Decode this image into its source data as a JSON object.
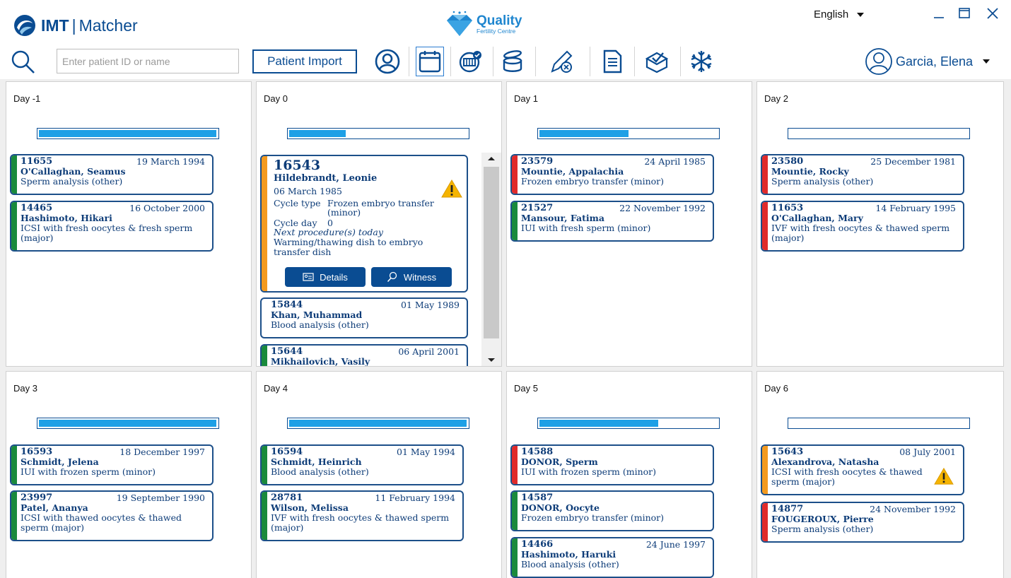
{
  "header": {
    "brand_imt": "IMT",
    "brand_sep": "|",
    "brand_product": "Matcher",
    "clinic_name": "Quality",
    "clinic_sub": "Fertility Centre",
    "language": "English",
    "search_placeholder": "Enter patient ID or name",
    "import_label": "Patient Import",
    "user_name": "Garcia, Elena"
  },
  "colors": {
    "brand": "#0a4c92",
    "progress": "#1ea0e6",
    "green": "#1a8a3c",
    "red": "#e02b2b",
    "orange": "#f39a1f"
  },
  "toolbar": {
    "icons": [
      "patient-icon",
      "calendar-icon",
      "incubator-icon",
      "dish-stack-icon",
      "tube-icon",
      "pen-cancel-icon",
      "document-icon",
      "verified-box-icon",
      "snowflake-icon"
    ]
  },
  "days": [
    {
      "title": "Day -1",
      "progress": 1.0
    },
    {
      "title": "Day 0",
      "progress": 0.32
    },
    {
      "title": "Day 1",
      "progress": 0.5
    },
    {
      "title": "Day 2",
      "progress": 0.0
    },
    {
      "title": "Day 3",
      "progress": 1.0
    },
    {
      "title": "Day 4",
      "progress": 1.0
    },
    {
      "title": "Day 5",
      "progress": 0.67
    },
    {
      "title": "Day 6",
      "progress": 0.0
    }
  ],
  "cards": {
    "d_1": [
      {
        "id": "11655",
        "date": "19 March 1994",
        "name": "O'Callaghan, Seamus",
        "proc": "Sperm analysis (other)",
        "status": "green"
      },
      {
        "id": "14465",
        "date": "16 October 2000",
        "name": "Hashimoto, Hikari",
        "proc": "ICSI with fresh oocytes & fresh sperm",
        "proc2": "(major)",
        "status": "green"
      }
    ],
    "d0_expanded": {
      "id": "16543",
      "name": "Hildebrandt, Leonie",
      "dob": "06 March 1985",
      "cycle_type_label": "Cycle type",
      "cycle_type_value": "Frozen embryo transfer",
      "cycle_type_value2": "(minor)",
      "cycle_day_label": "Cycle day",
      "cycle_day_value": "0",
      "next_label": "Next procedure(s) today",
      "next_value": "Warming/thawing dish to embryo",
      "next_value2": "transfer dish",
      "details_label": "Details",
      "witness_label": "Witness",
      "status": "orange"
    },
    "d0": [
      {
        "id": "15844",
        "date": "01 May 1989",
        "name": "Khan, Muhammad",
        "proc": "Blood analysis (other)",
        "status": "none"
      },
      {
        "id": "15644",
        "date": "06 April 2001",
        "name": "Mikhailovich, Vasily",
        "proc": "",
        "status": "green"
      }
    ],
    "d1": [
      {
        "id": "23579",
        "date": "24 April 1985",
        "name": "Mountie, Appalachia",
        "proc": "Frozen embryo transfer (minor)",
        "status": "red"
      },
      {
        "id": "21527",
        "date": "22 November 1992",
        "name": "Mansour, Fatima",
        "proc": "IUI with fresh sperm (minor)",
        "status": "green"
      }
    ],
    "d2": [
      {
        "id": "23580",
        "date": "25 December 1981",
        "name": "Mountie, Rocky",
        "proc": "Sperm analysis (other)",
        "status": "red"
      },
      {
        "id": "11653",
        "date": "14 February 1995",
        "name": "O'Callaghan, Mary",
        "proc": "IVF with fresh oocytes & thawed sperm",
        "proc2": "(major)",
        "status": "red"
      }
    ],
    "d3": [
      {
        "id": "16593",
        "date": "18 December 1997",
        "name": "Schmidt, Jelena",
        "proc": "IUI with frozen sperm (minor)",
        "status": "green"
      },
      {
        "id": "23997",
        "date": "19 September 1990",
        "name": "Patel, Ananya",
        "proc": "ICSI with thawed oocytes & thawed",
        "proc2": "sperm (major)",
        "status": "green"
      }
    ],
    "d4": [
      {
        "id": "16594",
        "date": "01 May 1994",
        "name": "Schmidt, Heinrich",
        "proc": "Blood analysis (other)",
        "status": "green"
      },
      {
        "id": "28781",
        "date": "11 February 1994",
        "name": "Wilson, Melissa",
        "proc": "IVF with fresh oocytes & thawed sperm",
        "proc2": "(major)",
        "status": "green"
      }
    ],
    "d5": [
      {
        "id": "14588",
        "date": "",
        "name": "DONOR, Sperm",
        "proc": "IUI with frozen sperm (minor)",
        "status": "red"
      },
      {
        "id": "14587",
        "date": "",
        "name": "DONOR, Oocyte",
        "proc": "Frozen embryo transfer (minor)",
        "status": "green"
      },
      {
        "id": "14466",
        "date": "24 June 1997",
        "name": "Hashimoto, Haruki",
        "proc": "Blood analysis (other)",
        "status": "green"
      }
    ],
    "d6": [
      {
        "id": "15643",
        "date": "08 July 2001",
        "name": "Alexandrova, Natasha",
        "proc": "ICSI with fresh oocytes & thawed",
        "proc2": "sperm (major)",
        "status": "orange",
        "warning": true
      },
      {
        "id": "14877",
        "date": "24 November 1992",
        "name": "FOUGEROUX, Pierre",
        "proc": "Sperm analysis (other)",
        "status": "red"
      }
    ]
  }
}
